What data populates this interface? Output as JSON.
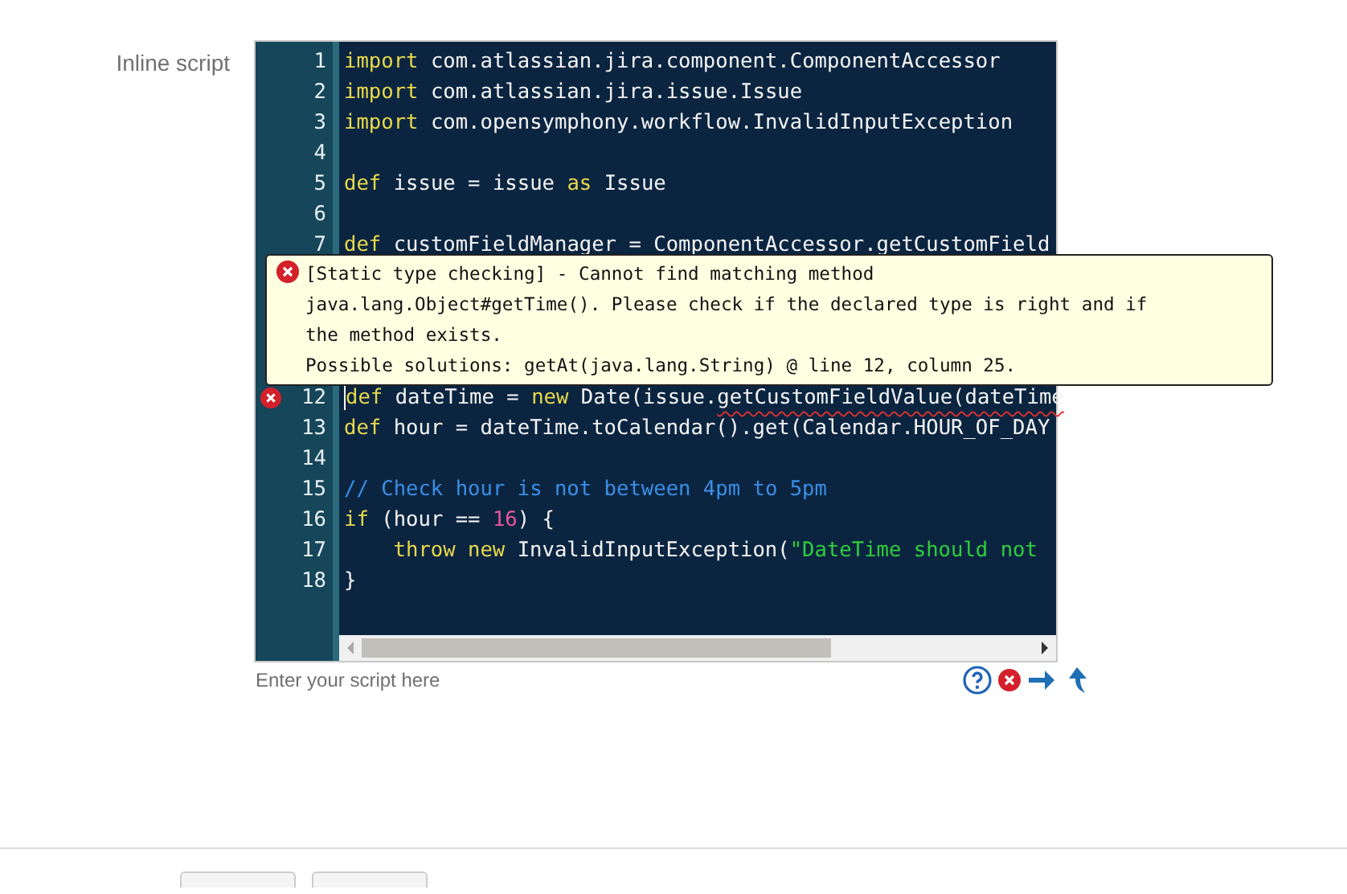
{
  "field": {
    "label": "Inline script",
    "hint": "Enter your script here"
  },
  "code_lines_top": [
    {
      "number": "1",
      "tokens": [
        {
          "kind": "keyword",
          "text": "import"
        },
        {
          "kind": "plain",
          "text": " com.atlassian.jira.component.ComponentAccessor"
        }
      ]
    },
    {
      "number": "2",
      "tokens": [
        {
          "kind": "keyword",
          "text": "import"
        },
        {
          "kind": "plain",
          "text": " com.atlassian.jira.issue.Issue"
        }
      ]
    },
    {
      "number": "3",
      "tokens": [
        {
          "kind": "keyword",
          "text": "import"
        },
        {
          "kind": "plain",
          "text": " com.opensymphony.workflow.InvalidInputException"
        }
      ]
    },
    {
      "number": "4"
    },
    {
      "number": "5",
      "tokens": [
        {
          "kind": "keyword",
          "text": "def"
        },
        {
          "kind": "plain",
          "text": " issue = issue "
        },
        {
          "kind": "keyword",
          "text": "as"
        },
        {
          "kind": "plain",
          "text": " Issue"
        }
      ]
    },
    {
      "number": "6"
    },
    {
      "number": "7",
      "tokens": [
        {
          "kind": "keyword",
          "text": "def"
        },
        {
          "kind": "plain",
          "text": " customFieldManager = ComponentAccessor.getCustomField"
        }
      ]
    }
  ],
  "tooltip": {
    "lines": [
      "[Static type checking] - Cannot find matching method",
      "java.lang.Object#getTime(). Please check if the declared type is right and if",
      "the method exists.",
      "Possible solutions: getAt(java.lang.String) @ line 12, column 25."
    ]
  },
  "code_lines_bottom": [
    {
      "number": "12",
      "error": true,
      "cursor": true,
      "tokens": [
        {
          "kind": "keyword",
          "text": "def"
        },
        {
          "kind": "plain",
          "text": " dateTime = "
        },
        {
          "kind": "keyword",
          "text": "new"
        },
        {
          "kind": "plain",
          "text": " Date(issue."
        },
        {
          "kind": "plain",
          "text": "getCustomFieldValue(dateTime",
          "underlined": true
        }
      ]
    },
    {
      "number": "13",
      "tokens": [
        {
          "kind": "keyword",
          "text": "def"
        },
        {
          "kind": "plain",
          "text": " hour = dateTime.toCalendar().get(Calendar.HOUR_OF_DAY"
        }
      ]
    },
    {
      "number": "14"
    },
    {
      "number": "15",
      "tokens": [
        {
          "kind": "comment",
          "text": "// Check hour is not between 4pm to 5pm"
        }
      ]
    },
    {
      "number": "16",
      "tokens": [
        {
          "kind": "keyword",
          "text": "if"
        },
        {
          "kind": "plain",
          "text": " (hour == "
        },
        {
          "kind": "number",
          "text": "16"
        },
        {
          "kind": "plain",
          "text": ") {"
        }
      ]
    },
    {
      "number": "17",
      "indented": true,
      "tokens": [
        {
          "kind": "keyword",
          "text": "throw new"
        },
        {
          "kind": "plain",
          "text": " InvalidInputException("
        },
        {
          "kind": "string",
          "text": "\"DateTime should not"
        }
      ]
    },
    {
      "number": "18",
      "tokens": [
        {
          "kind": "plain",
          "text": "}"
        }
      ]
    }
  ],
  "footer_buttons": [
    {
      "kind": "button"
    },
    {
      "kind": "button"
    }
  ]
}
